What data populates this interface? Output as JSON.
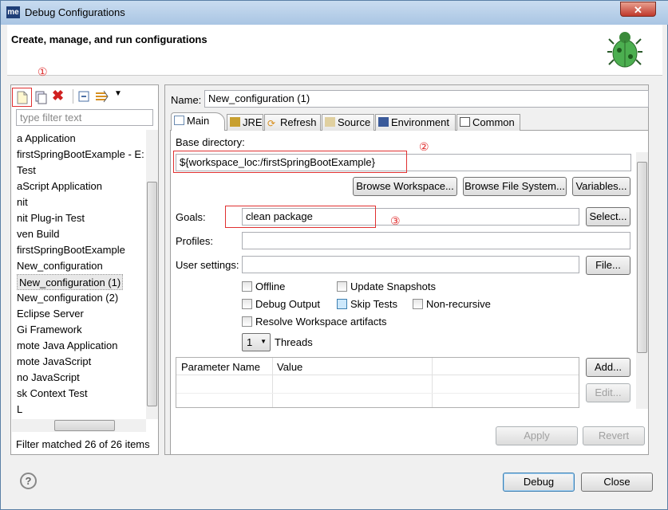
{
  "window": {
    "title": "Debug Configurations",
    "app_icon": "me",
    "close_label": "✕"
  },
  "header": {
    "title": "Create, manage, and run configurations",
    "logo_icon": "debug-bug-icon"
  },
  "annotations": [
    "①",
    "②",
    "③"
  ],
  "left": {
    "filter_placeholder": "type filter text",
    "items": [
      "a Application",
      "firstSpringBootExample - E:",
      "Test",
      "aScript Application",
      "nit",
      "nit Plug-in Test",
      "ven Build",
      "firstSpringBootExample",
      "New_configuration",
      "New_configuration (1)",
      "New_configuration (2)",
      "Eclipse Server",
      "Gi Framework",
      "mote Java Application",
      "mote JavaScript",
      "no JavaScript",
      "sk Context Test",
      "L"
    ],
    "selected_index": 9,
    "status": "Filter matched 26 of 26 items"
  },
  "main": {
    "name_label": "Name:",
    "name_value": "New_configuration (1)",
    "tabs": [
      "Main",
      "JRE",
      "Refresh",
      "Source",
      "Environment",
      "Common"
    ],
    "active_tab": "Main",
    "base_dir_label": "Base directory:",
    "base_dir_value": "${workspace_loc:/firstSpringBootExample}",
    "browse_workspace": "Browse Workspace...",
    "browse_fs": "Browse File System...",
    "variables": "Variables...",
    "goals_label": "Goals:",
    "goals_value": "clean package",
    "select": "Select...",
    "profiles_label": "Profiles:",
    "profiles_value": "",
    "user_settings_label": "User settings:",
    "user_settings_value": "",
    "file": "File...",
    "checkboxes": [
      {
        "label": "Offline",
        "checked": false
      },
      {
        "label": "Update Snapshots",
        "checked": false
      },
      {
        "label": "Debug Output",
        "checked": false
      },
      {
        "label": "Skip Tests",
        "checked": false
      },
      {
        "label": "Non-recursive",
        "checked": false
      },
      {
        "label": "Resolve Workspace artifacts",
        "checked": false
      }
    ],
    "threads_value": "1",
    "threads_label": "Threads",
    "table_headers": [
      "Parameter Name",
      "Value"
    ],
    "add": "Add...",
    "edit": "Edit...",
    "apply": "Apply",
    "revert": "Revert"
  },
  "footer": {
    "help": "?",
    "debug": "Debug",
    "close": "Close"
  }
}
